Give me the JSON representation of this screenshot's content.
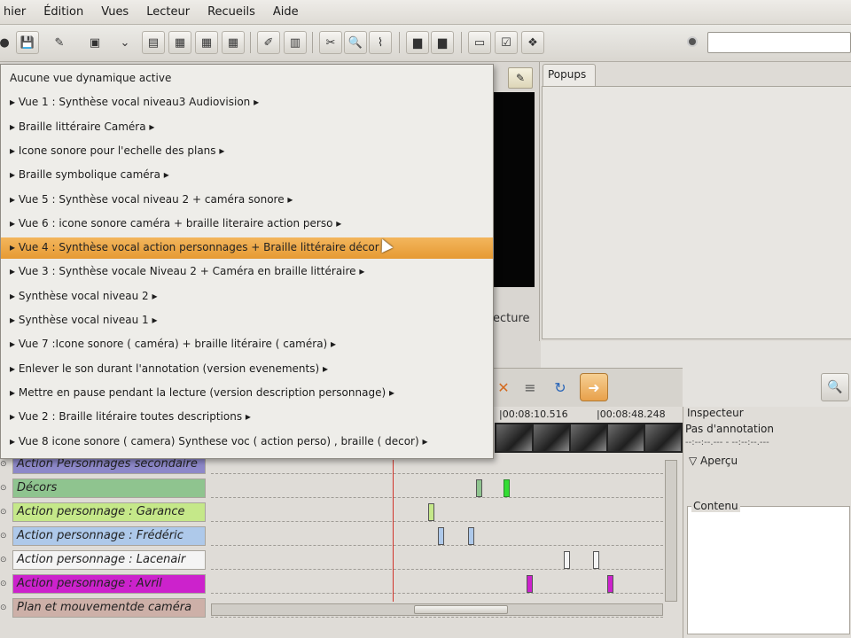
{
  "menubar": {
    "items": [
      "hier",
      "Édition",
      "Vues",
      "Lecteur",
      "Recueils",
      "Aide"
    ]
  },
  "dropdown": {
    "items": [
      "Aucune vue dynamique active",
      "▸ Vue 1 : Synthèse vocal niveau3 Audiovision ▸",
      "▸ Braille littéraire Caméra ▸",
      "▸ Icone sonore pour l'echelle des plans ▸",
      "▸ Braille symbolique caméra ▸",
      "▸ Vue 5 : Synthèse vocal niveau 2 + caméra sonore ▸",
      "▸ Vue 6 : icone sonore caméra + braille literaire action perso ▸",
      "▸ Vue 4 : Synthèse vocal action personnages + Braille littéraire décor ▸",
      "▸ Vue 3 : Synthèse vocale Niveau 2 + Caméra en braille littéraire ▸",
      "▸ Synthèse vocal niveau 2 ▸",
      "▸ Synthèse vocal niveau 1 ▸",
      "▸ Vue 7 :Icone sonore ( caméra) + braille litéraire ( caméra) ▸",
      "▸ Enlever le son durant l'annotation (version evenements) ▸",
      "▸ Mettre en pause pendant la lecture (version description personnage) ▸",
      "▸ Vue 2 : Braille litéraire toutes descriptions ▸",
      "▸ Vue 8 icone sonore ( camera) Synthese voc ( action perso) , braille ( decor) ▸"
    ],
    "highlighted_index": 7
  },
  "video": {
    "lecture_label": "ecture"
  },
  "popups": {
    "tab_label": "Popups"
  },
  "timeline": {
    "timestamps": [
      "|00:08:10.516",
      "|00:08:48.248"
    ],
    "tracks": [
      {
        "label": "Action Personnages secondaire",
        "color": "#8d88c9"
      },
      {
        "label": "Décors",
        "color": "#8fc48f"
      },
      {
        "label": "Action personnage : Garance",
        "color": "#c5e889"
      },
      {
        "label": "Action personnage : Frédéric",
        "color": "#aec9ea"
      },
      {
        "label": "Action personnage : Lacenair",
        "color": "#f4f4f4"
      },
      {
        "label": "Action personnage : Avril",
        "color": "#cc22cc"
      },
      {
        "label": "Plan et mouvementde caméra",
        "color": "#cdb0a8"
      }
    ]
  },
  "inspector": {
    "title": "Inspecteur",
    "subtitle": "Pas d'annotation",
    "dashes": "--:--:--.--- - --:--:--.---",
    "apercu": "Aperçu",
    "contenu": "Contenu"
  },
  "colors": {
    "highlight": "#e69a33",
    "playhead": "#d0352b",
    "accent_orange": "#e8a14b"
  }
}
